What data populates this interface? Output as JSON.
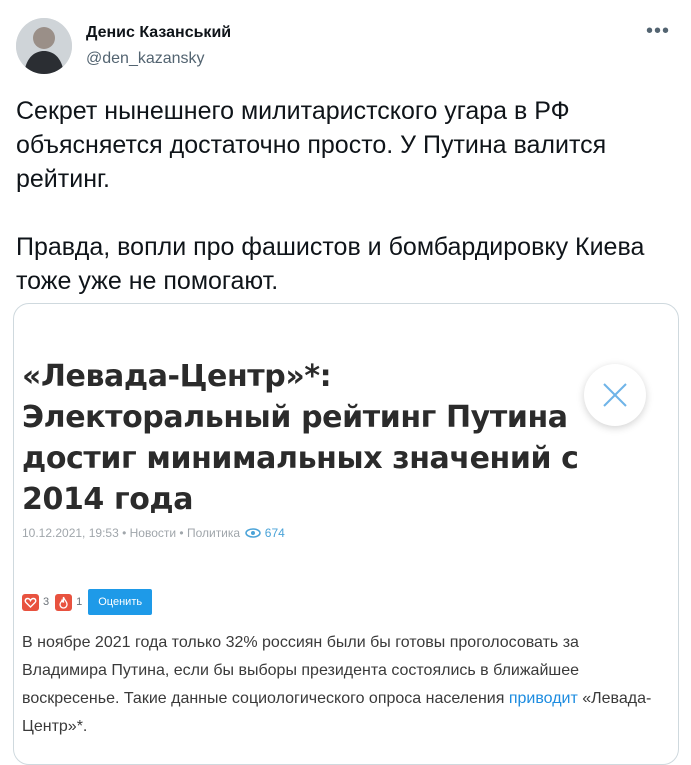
{
  "author": {
    "name": "Денис Казанський",
    "handle": "@den_kazansky"
  },
  "tweet": {
    "text": "Секрет нынешнего милитаристского угара в РФ объясняется достаточно просто. У Путина валится рейтинг.\n\nПравда, вопли про фашистов и бомбардировку Киева тоже уже не помогают."
  },
  "card": {
    "headline": "«Левада-Центр»*: Электоральный рейтинг Путина достиг минимальных значений с 2014 года",
    "meta": "10.12.2021, 19:53 • Новости • Политика",
    "views": "674",
    "reaction_heart_count": "3",
    "reaction_fire_count": "1",
    "rate_label": "Оценить",
    "article_text": "В ноябре 2021 года только 32% россиян были бы готовы проголосовать за Владимира Путина, если бы выборы президента состоялись в ближайшее воскресенье. Такие данные социологического опроса населения ",
    "article_link": "приводит",
    "article_tail": " «Левада-Центр»*."
  },
  "icons": {
    "more": "more-horizontal-icon",
    "close": "close-icon",
    "views": "eye-icon",
    "heart": "heart-icon",
    "fire": "fire-icon"
  }
}
